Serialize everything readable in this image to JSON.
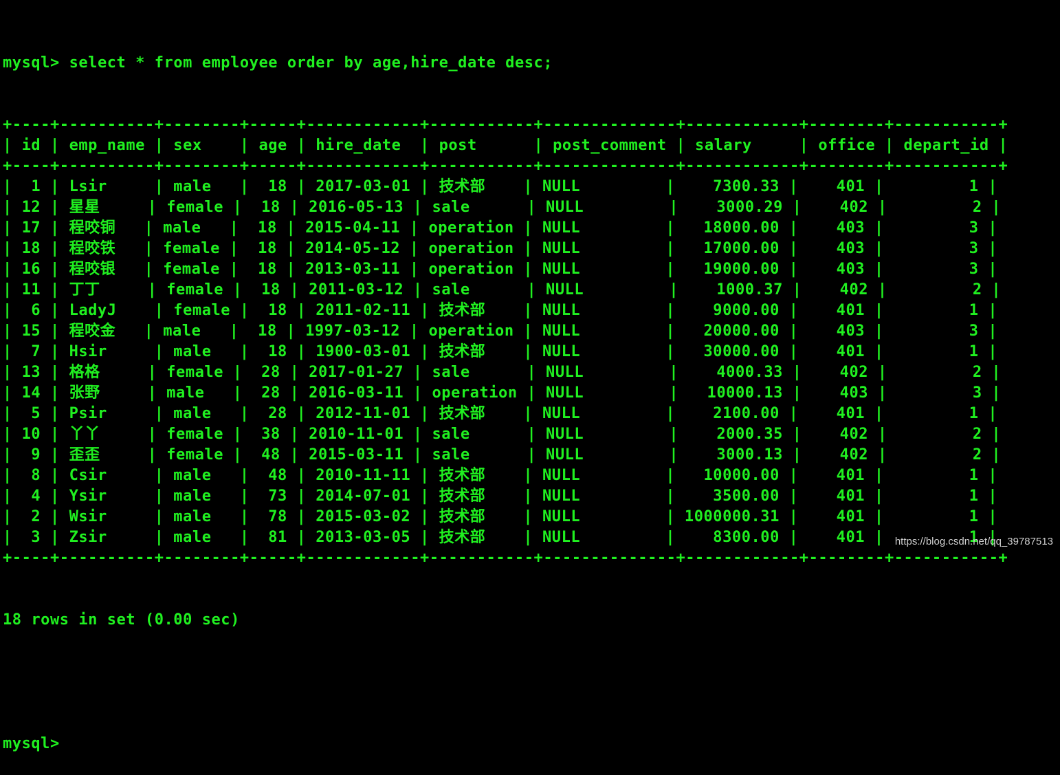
{
  "terminal": {
    "prompt": "mysql> ",
    "command": "select * from employee order by age,hire_date desc;",
    "table": {
      "columns": [
        {
          "name": "id",
          "align": "right"
        },
        {
          "name": "emp_name",
          "align": "left"
        },
        {
          "name": "sex",
          "align": "left"
        },
        {
          "name": "age",
          "align": "right"
        },
        {
          "name": "hire_date",
          "align": "left"
        },
        {
          "name": "post",
          "align": "left"
        },
        {
          "name": "post_comment",
          "align": "left"
        },
        {
          "name": "salary",
          "align": "right"
        },
        {
          "name": "office",
          "align": "right"
        },
        {
          "name": "depart_id",
          "align": "right"
        }
      ],
      "rows": [
        [
          "1",
          "Lsir",
          "male",
          "18",
          "2017-03-01",
          "技术部",
          "NULL",
          "7300.33",
          "401",
          "1"
        ],
        [
          "12",
          "星星",
          "female",
          "18",
          "2016-05-13",
          "sale",
          "NULL",
          "3000.29",
          "402",
          "2"
        ],
        [
          "17",
          "程咬铜",
          "male",
          "18",
          "2015-04-11",
          "operation",
          "NULL",
          "18000.00",
          "403",
          "3"
        ],
        [
          "18",
          "程咬铁",
          "female",
          "18",
          "2014-05-12",
          "operation",
          "NULL",
          "17000.00",
          "403",
          "3"
        ],
        [
          "16",
          "程咬银",
          "female",
          "18",
          "2013-03-11",
          "operation",
          "NULL",
          "19000.00",
          "403",
          "3"
        ],
        [
          "11",
          "丁丁",
          "female",
          "18",
          "2011-03-12",
          "sale",
          "NULL",
          "1000.37",
          "402",
          "2"
        ],
        [
          "6",
          "LadyJ",
          "female",
          "18",
          "2011-02-11",
          "技术部",
          "NULL",
          "9000.00",
          "401",
          "1"
        ],
        [
          "15",
          "程咬金",
          "male",
          "18",
          "1997-03-12",
          "operation",
          "NULL",
          "20000.00",
          "403",
          "3"
        ],
        [
          "7",
          "Hsir",
          "male",
          "18",
          "1900-03-01",
          "技术部",
          "NULL",
          "30000.00",
          "401",
          "1"
        ],
        [
          "13",
          "格格",
          "female",
          "28",
          "2017-01-27",
          "sale",
          "NULL",
          "4000.33",
          "402",
          "2"
        ],
        [
          "14",
          "张野",
          "male",
          "28",
          "2016-03-11",
          "operation",
          "NULL",
          "10000.13",
          "403",
          "3"
        ],
        [
          "5",
          "Psir",
          "male",
          "28",
          "2012-11-01",
          "技术部",
          "NULL",
          "2100.00",
          "401",
          "1"
        ],
        [
          "10",
          "丫丫",
          "female",
          "38",
          "2010-11-01",
          "sale",
          "NULL",
          "2000.35",
          "402",
          "2"
        ],
        [
          "9",
          "歪歪",
          "female",
          "48",
          "2015-03-11",
          "sale",
          "NULL",
          "3000.13",
          "402",
          "2"
        ],
        [
          "8",
          "Csir",
          "male",
          "48",
          "2010-11-11",
          "技术部",
          "NULL",
          "10000.00",
          "401",
          "1"
        ],
        [
          "4",
          "Ysir",
          "male",
          "73",
          "2014-07-01",
          "技术部",
          "NULL",
          "3500.00",
          "401",
          "1"
        ],
        [
          "2",
          "Wsir",
          "male",
          "78",
          "2015-03-02",
          "技术部",
          "NULL",
          "1000000.31",
          "401",
          "1"
        ],
        [
          "3",
          "Zsir",
          "male",
          "81",
          "2013-03-05",
          "技术部",
          "NULL",
          "8300.00",
          "401",
          "1"
        ]
      ]
    },
    "result_summary": "18 rows in set (0.00 sec)",
    "final_prompt": "mysql> "
  },
  "watermark": "https://blog.csdn.net/qq_39787513",
  "colors": {
    "background": "#000000",
    "text": "#20f020",
    "watermark": "#cfcfcf"
  }
}
